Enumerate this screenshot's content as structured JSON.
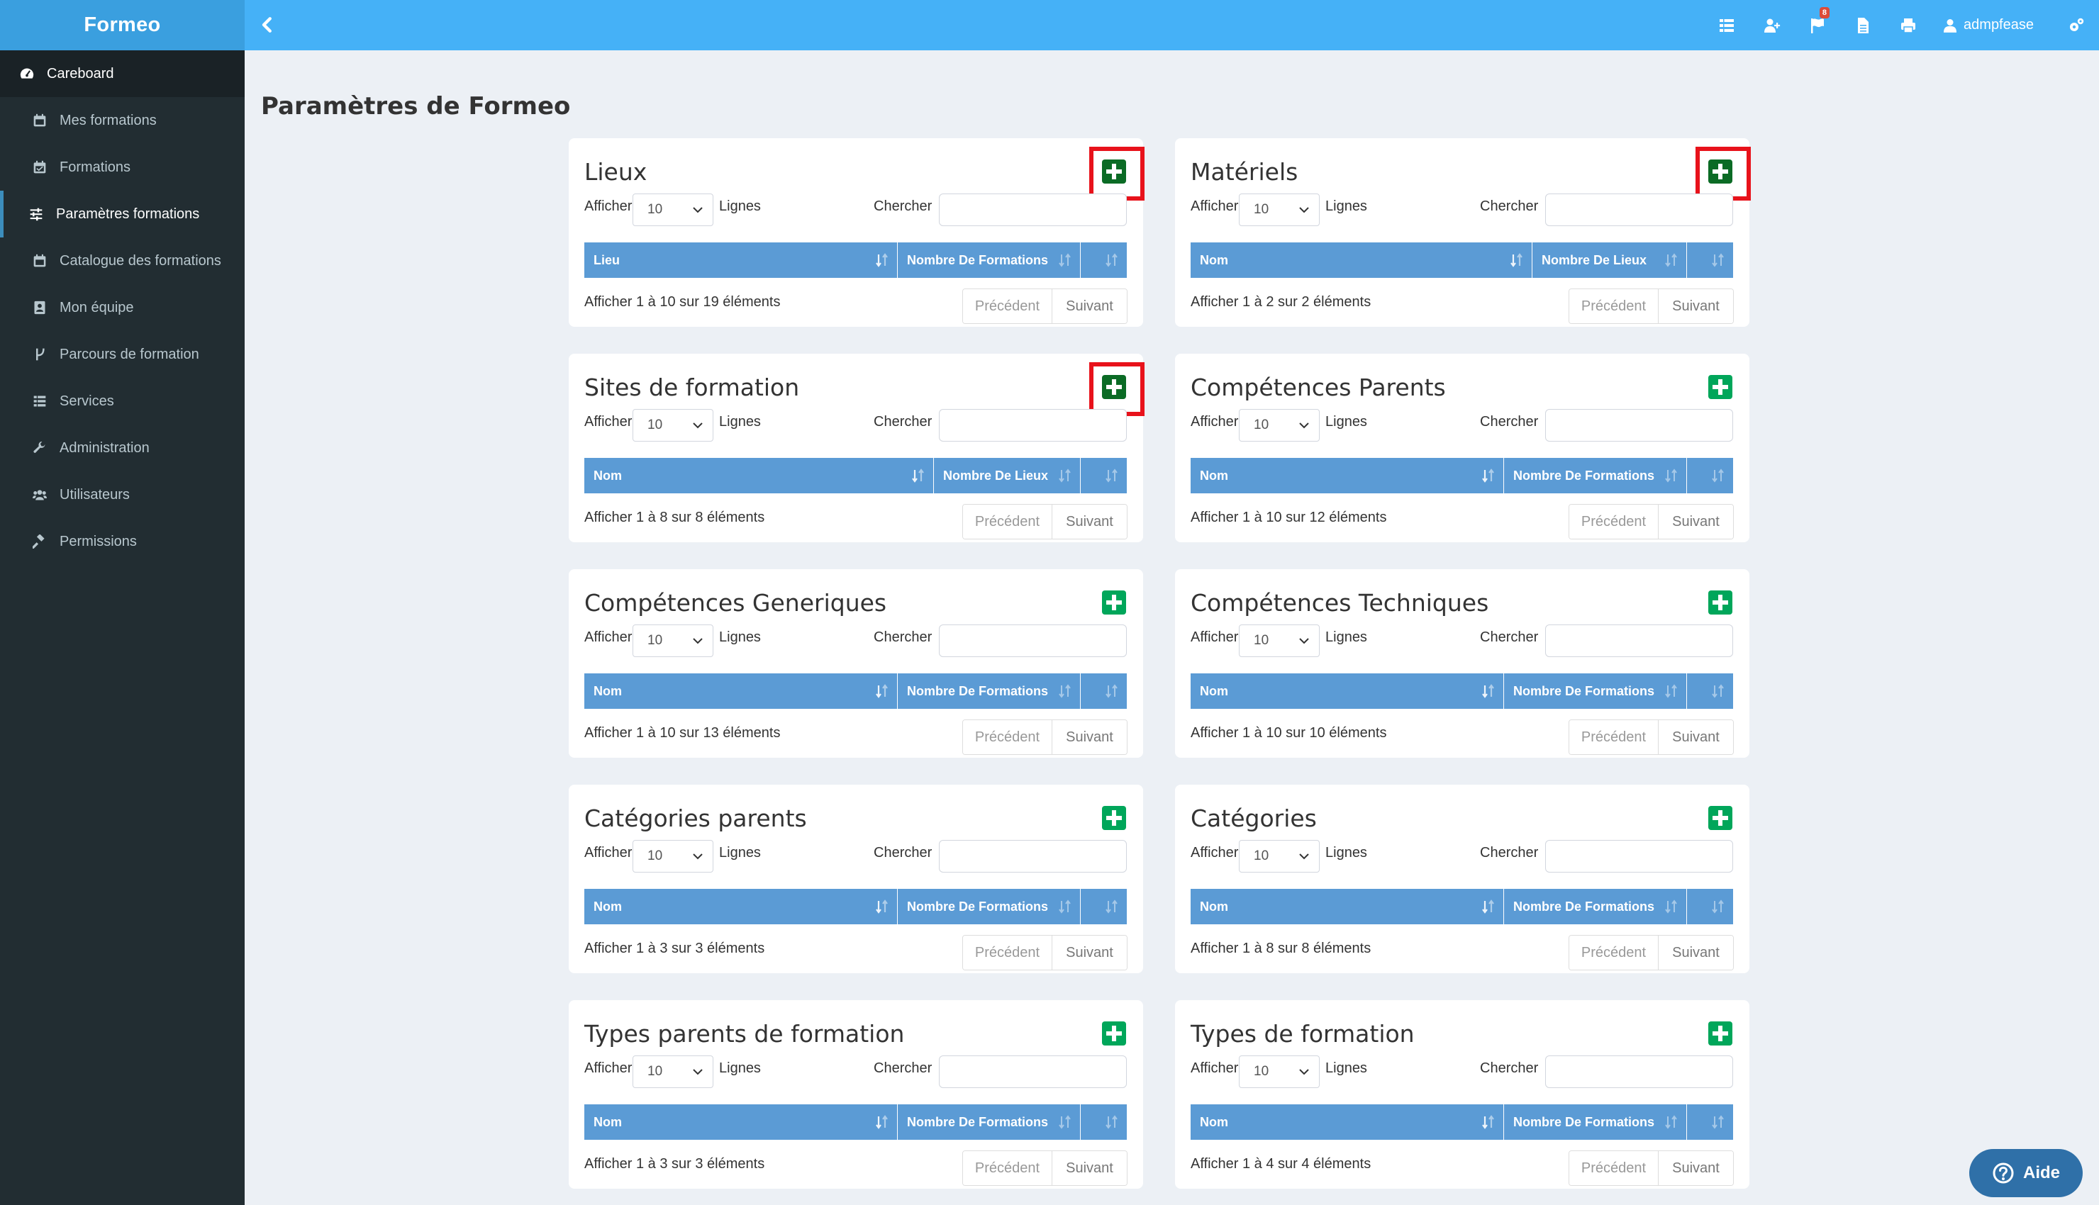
{
  "app": {
    "brand": "Formeo"
  },
  "topbar": {
    "notification_count": "8",
    "username": "admpfease",
    "icons": [
      "list-icon",
      "user-plus-icon",
      "flag-icon",
      "file-icon",
      "print-icon",
      "user-icon",
      "cogs-icon"
    ]
  },
  "sidebar": {
    "items": [
      {
        "label": "Careboard",
        "icon": "dashboard-icon"
      },
      {
        "label": "Mes formations",
        "icon": "calendar-icon"
      },
      {
        "label": "Formations",
        "icon": "calendar-check-icon"
      },
      {
        "label": "Paramètres formations",
        "icon": "sliders-icon"
      },
      {
        "label": "Catalogue des formations",
        "icon": "calendar-icon"
      },
      {
        "label": "Mon équipe",
        "icon": "contact-icon"
      },
      {
        "label": "Parcours de formation",
        "icon": "route-icon"
      },
      {
        "label": "Services",
        "icon": "list-icon"
      },
      {
        "label": "Administration",
        "icon": "wrench-icon"
      },
      {
        "label": "Utilisateurs",
        "icon": "users-icon"
      },
      {
        "label": "Permissions",
        "icon": "gavel-icon"
      }
    ]
  },
  "main": {
    "title": "Paramètres de Formeo",
    "common": {
      "show_label": "Afficher",
      "page_length": "10",
      "rows_label": "Lignes",
      "search_label": "Chercher",
      "prev_label": "Précédent",
      "next_label": "Suivant"
    },
    "panels": [
      {
        "title": "Lieux",
        "col1": "Lieu",
        "col2": "Nombre De Formations",
        "info": "Afficher 1 à 10 sur 19 éléments"
      },
      {
        "title": "Matériels",
        "col1": "Nom",
        "col2": "Nombre De Lieux",
        "info": "Afficher 1 à 2 sur 2 éléments"
      },
      {
        "title": "Sites de formation",
        "col1": "Nom",
        "col2": "Nombre De Lieux",
        "info": "Afficher 1 à 8 sur 8 éléments"
      },
      {
        "title": "Compétences Parents",
        "col1": "Nom",
        "col2": "Nombre De Formations",
        "info": "Afficher 1 à 10 sur 12 éléments"
      },
      {
        "title": "Compétences Generiques",
        "col1": "Nom",
        "col2": "Nombre De Formations",
        "info": "Afficher 1 à 10 sur 13 éléments"
      },
      {
        "title": "Compétences Techniques",
        "col1": "Nom",
        "col2": "Nombre De Formations",
        "info": "Afficher 1 à 10 sur 10 éléments"
      },
      {
        "title": "Catégories parents",
        "col1": "Nom",
        "col2": "Nombre De Formations",
        "info": "Afficher 1 à 3 sur 3 éléments"
      },
      {
        "title": "Catégories",
        "col1": "Nom",
        "col2": "Nombre De Formations",
        "info": "Afficher 1 à 8 sur 8 éléments"
      },
      {
        "title": "Types parents de formation",
        "col1": "Nom",
        "col2": "Nombre De Formations",
        "info": "Afficher 1 à 3 sur 3 éléments"
      },
      {
        "title": "Types de formation",
        "col1": "Nom",
        "col2": "Nombre De Formations",
        "info": "Afficher 1 à 4 sur 4 éléments"
      }
    ]
  },
  "help": {
    "label": "Aide"
  },
  "colors": {
    "topbar": "#45b1f7",
    "sidebar": "#222d32",
    "table_header": "#5b9bd5",
    "add_button": "#00a65a",
    "highlight": "#e8121b"
  }
}
